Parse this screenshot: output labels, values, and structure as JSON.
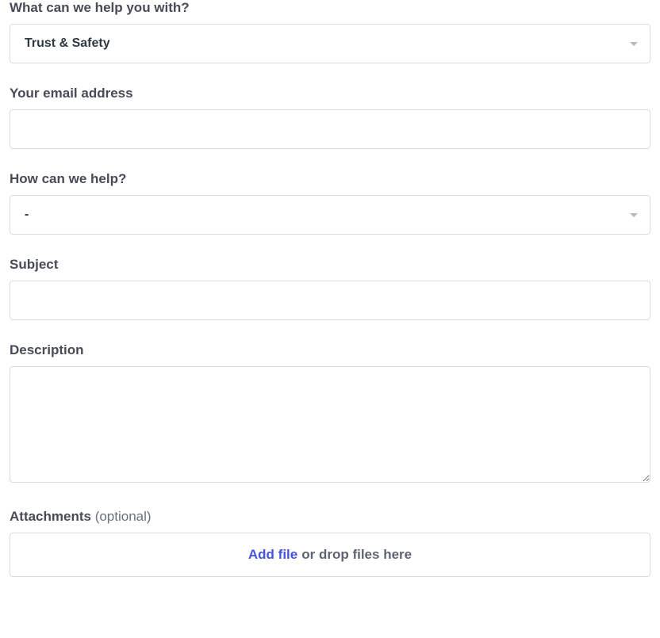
{
  "form": {
    "category": {
      "label": "What can we help you with?",
      "selected": "Trust & Safety"
    },
    "email": {
      "label": "Your email address",
      "value": ""
    },
    "help_type": {
      "label": "How can we help?",
      "selected": "-"
    },
    "subject": {
      "label": "Subject",
      "value": ""
    },
    "description": {
      "label": "Description",
      "value": ""
    },
    "attachments": {
      "label": "Attachments ",
      "optional": "(optional)",
      "link_text": "Add file",
      "suffix_text": " or drop files here"
    }
  }
}
